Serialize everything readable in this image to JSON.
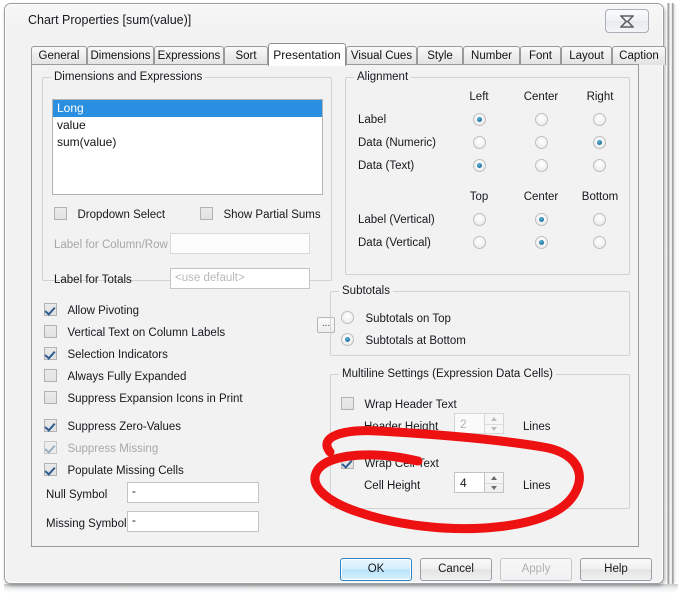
{
  "window": {
    "title": "Chart Properties [sum(value)]",
    "close_icon": "close-icon",
    "close_glyph": "✖"
  },
  "tabs": [
    {
      "label": "General",
      "active": false
    },
    {
      "label": "Dimensions",
      "active": false
    },
    {
      "label": "Expressions",
      "active": false
    },
    {
      "label": "Sort",
      "active": false
    },
    {
      "label": "Presentation",
      "active": true
    },
    {
      "label": "Visual Cues",
      "active": false
    },
    {
      "label": "Style",
      "active": false
    },
    {
      "label": "Number",
      "active": false
    },
    {
      "label": "Font",
      "active": false
    },
    {
      "label": "Layout",
      "active": false
    },
    {
      "label": "Caption",
      "active": false
    }
  ],
  "dimensions_group": {
    "title": "Dimensions and Expressions",
    "list": [
      {
        "label": "Long",
        "selected": true
      },
      {
        "label": "value",
        "selected": false
      },
      {
        "label": "sum(value)",
        "selected": false
      }
    ],
    "dropdown_select": {
      "label": "Dropdown Select",
      "checked": false
    },
    "show_partial_sums": {
      "label": "Show Partial Sums",
      "checked": false
    },
    "label_column_row": {
      "label": "Label for Column/Row",
      "value": "",
      "disabled": true
    },
    "label_totals": {
      "label": "Label for Totals",
      "placeholder": "<use default>",
      "value": "",
      "browse": "..."
    }
  },
  "alignment_group": {
    "title": "Alignment",
    "horizontal_headers": [
      "Left",
      "Center",
      "Right"
    ],
    "horizontal_rows": [
      {
        "label": "Label",
        "selected": "Left"
      },
      {
        "label": "Data (Numeric)",
        "selected": "Right"
      },
      {
        "label": "Data (Text)",
        "selected": "Left"
      }
    ],
    "vertical_headers": [
      "Top",
      "Center",
      "Bottom"
    ],
    "vertical_rows": [
      {
        "label": "Label (Vertical)",
        "selected": "Center"
      },
      {
        "label": "Data (Vertical)",
        "selected": "Center"
      }
    ]
  },
  "options": [
    {
      "label": "Allow Pivoting",
      "checked": true,
      "disabled": false
    },
    {
      "label": "Vertical Text on Column Labels",
      "checked": false,
      "disabled": false
    },
    {
      "label": "Selection Indicators",
      "checked": true,
      "disabled": false
    },
    {
      "label": "Always Fully Expanded",
      "checked": false,
      "disabled": false
    },
    {
      "label": "Suppress Expansion Icons in Print",
      "checked": false,
      "disabled": false
    },
    {
      "label": "Suppress Zero-Values",
      "checked": true,
      "disabled": false
    },
    {
      "label": "Suppress Missing",
      "checked": true,
      "disabled": true
    },
    {
      "label": "Populate Missing Cells",
      "checked": true,
      "disabled": false
    }
  ],
  "symbols": {
    "null_label": "Null Symbol",
    "null_value": "-",
    "missing_label": "Missing Symbol",
    "missing_value": "-"
  },
  "subtotals_group": {
    "title": "Subtotals",
    "options": [
      {
        "label": "Subtotals on Top",
        "selected": false
      },
      {
        "label": "Subtotals at Bottom",
        "selected": true
      }
    ]
  },
  "multiline_group": {
    "title": "Multiline Settings (Expression Data Cells)",
    "wrap_header_text": {
      "label": "Wrap Header Text",
      "checked": false
    },
    "header_height": {
      "label": "Header Height",
      "value": "2",
      "units": "Lines",
      "disabled": true
    },
    "wrap_cell_text": {
      "label": "Wrap Cell Text",
      "checked": true
    },
    "cell_height": {
      "label": "Cell Height",
      "value": "4",
      "units": "Lines",
      "disabled": false
    }
  },
  "buttons": [
    {
      "label": "OK",
      "style": "default"
    },
    {
      "label": "Cancel",
      "style": "normal"
    },
    {
      "label": "Apply",
      "style": "disabled"
    },
    {
      "label": "Help",
      "style": "normal"
    }
  ],
  "annotation": {
    "shape": "hand-drawn-ellipse",
    "color": "#ee1111",
    "stroke_width": 9
  }
}
